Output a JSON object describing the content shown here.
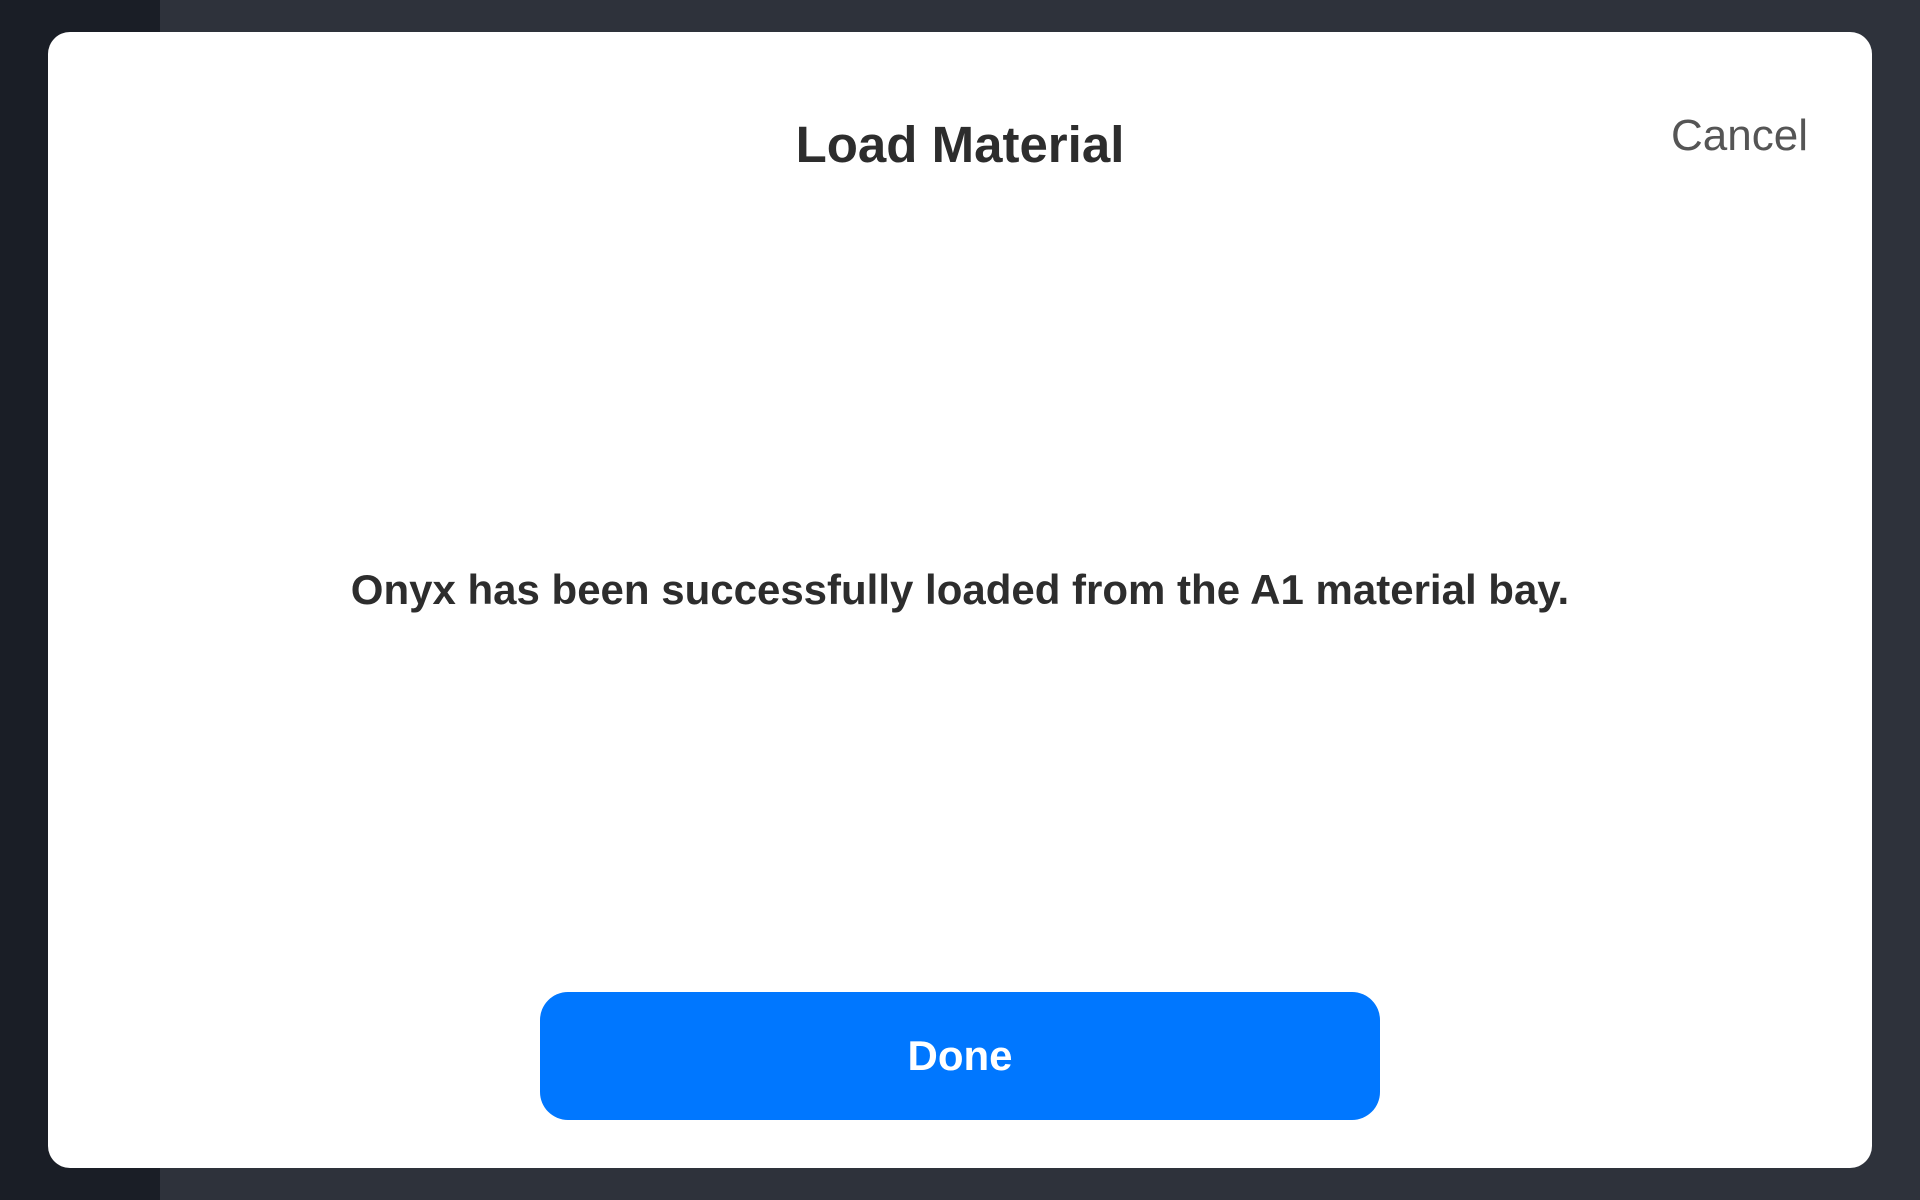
{
  "dialog": {
    "title": "Load Material",
    "cancel_label": "Cancel",
    "message": "Onyx has been successfully loaded from the A1 material bay.",
    "done_label": "Done"
  },
  "colors": {
    "primary": "#0077ff",
    "backdrop": "#2e323b",
    "text": "#2d2d2d",
    "muted_text": "#555555"
  }
}
